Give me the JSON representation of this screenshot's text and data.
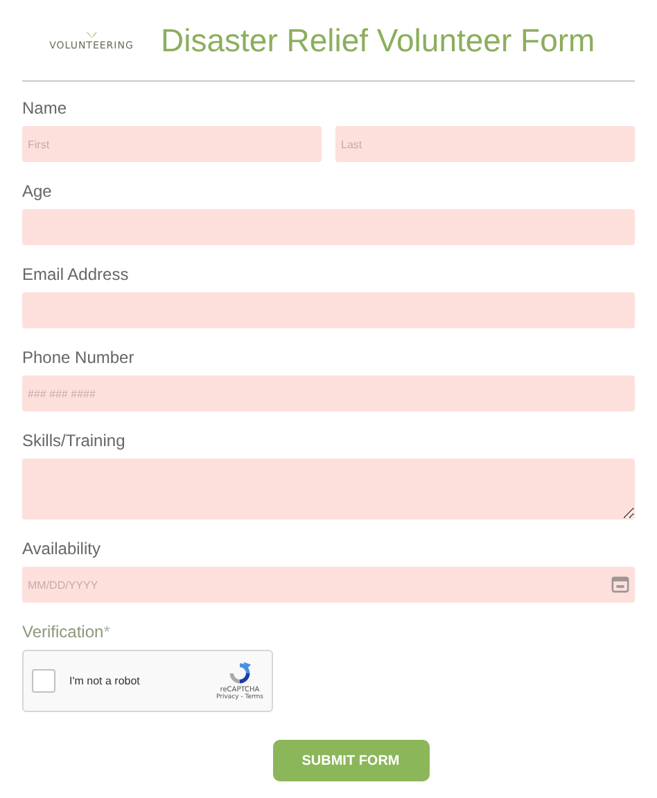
{
  "header": {
    "logo_text": "VOLUNTEERING",
    "title": "Disaster Relief Volunteer Form"
  },
  "fields": [
    {
      "kind": "name",
      "label": "Name",
      "parts": [
        {
          "placeholder": "First"
        },
        {
          "placeholder": "Last"
        }
      ]
    },
    {
      "kind": "text",
      "label": "Age"
    },
    {
      "kind": "text",
      "label": "Email Address"
    },
    {
      "kind": "text",
      "label": "Phone Number",
      "placeholder": "### ### ####"
    },
    {
      "kind": "textarea",
      "label": "Skills/Training"
    },
    {
      "kind": "date",
      "label": "Availability",
      "placeholder": "MM/DD/YYYY"
    },
    {
      "kind": "captcha",
      "label": "Verification",
      "required_mark": "*",
      "checkbox_label": "I'm not a robot",
      "checked": false,
      "brand": "reCAPTCHA",
      "links": "Privacy - Terms"
    }
  ],
  "submit": "SUBMIT FORM"
}
